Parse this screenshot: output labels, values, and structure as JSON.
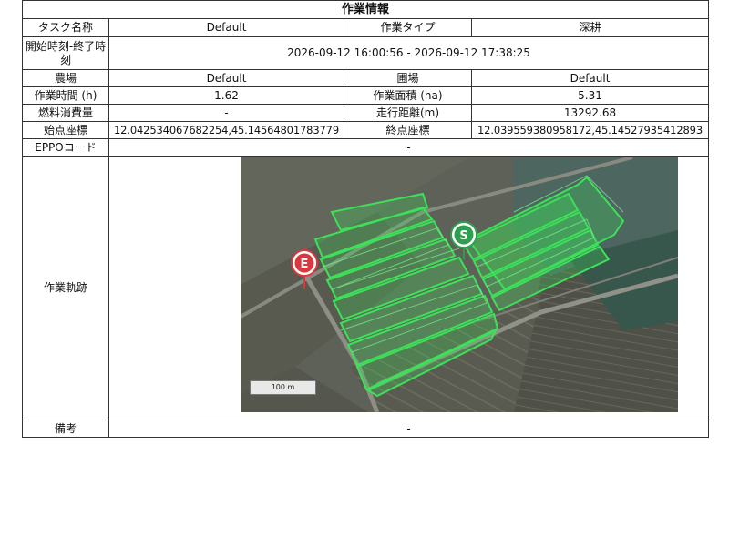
{
  "report": {
    "title": "作業情報",
    "task_name_label": "タスク名称",
    "task_name_value": "Default",
    "work_type_label": "作業タイプ",
    "work_type_value": "深耕",
    "time_label": "開始時刻-終了時刻",
    "time_value": "2026-09-12 16:00:56 - 2026-09-12 17:38:25",
    "farm_label": "農場",
    "farm_value": "Default",
    "field_label": "圃場",
    "field_value": "Default",
    "work_hours_label": "作業時間 (h)",
    "work_hours_value": "1.62",
    "work_area_label": "作業面積 (ha)",
    "work_area_value": "5.31",
    "fuel_label": "燃料消費量",
    "fuel_value": "-",
    "distance_label": "走行距離(m)",
    "distance_value": "13292.68",
    "start_coord_label": "始点座標",
    "start_coord_value": "12.042534067682254,45.14564801783779",
    "end_coord_label": "終点座標",
    "end_coord_value": "12.039559380958172,45.14527935412893",
    "eppo_label": "EPPOコード",
    "eppo_value": "-",
    "track_label": "作業軌跡",
    "remarks_label": "備考",
    "remarks_value": "-"
  },
  "map": {
    "start_marker": "S",
    "end_marker": "E",
    "scale_label": "100 m",
    "track_color": "#3ee05a",
    "start_color": "#2e9e4f",
    "end_color": "#d9393e"
  }
}
